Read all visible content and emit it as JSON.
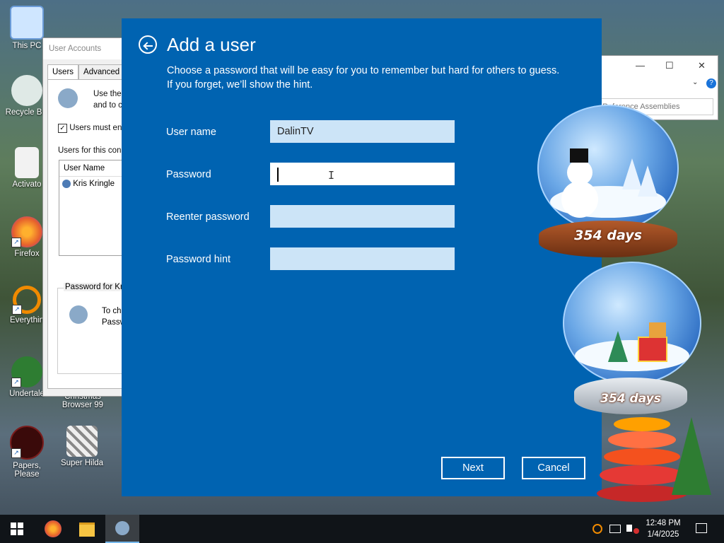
{
  "desktop": {
    "icons": [
      {
        "label": "This PC"
      },
      {
        "label": "Recycle Bin"
      },
      {
        "label": "Activato"
      },
      {
        "label": "Firefox"
      },
      {
        "label": "Everythin"
      },
      {
        "label": "Undertale"
      },
      {
        "label": "Papers, Please"
      },
      {
        "label": "Super Hilda"
      },
      {
        "label": "Christmas Browser 99"
      }
    ]
  },
  "user_accounts_window": {
    "title": "User Accounts",
    "tabs": [
      "Users",
      "Advanced"
    ],
    "intro_line1": "Use the",
    "intro_line2": "and to c",
    "checkbox_label": "Users must en",
    "users_for_label": "Users for this con",
    "list_header": "User Name",
    "list_user": "Kris Kringle",
    "password_group_label": "Password for Kr",
    "password_text1": "To ch",
    "password_text2": "Passw"
  },
  "explorer_window": {
    "search_placeholder": "Reference Assemblies"
  },
  "dialog": {
    "title": "Add a user",
    "description": "Choose a password that will be easy for you to remember but hard for others to guess. If you forget, we’ll show the hint.",
    "fields": {
      "username": {
        "label": "User name",
        "value": "DalinTV"
      },
      "password": {
        "label": "Password",
        "value": ""
      },
      "reenter": {
        "label": "Reenter password",
        "value": ""
      },
      "hint": {
        "label": "Password hint",
        "value": ""
      }
    },
    "buttons": {
      "next": "Next",
      "cancel": "Cancel"
    }
  },
  "countdown": {
    "label1": "354 days",
    "label2": "354 days"
  },
  "taskbar": {
    "time": "12:48 PM",
    "date": "1/4/2025",
    "items": [
      "start-icon",
      "firefox-icon",
      "file-explorer-icon",
      "user-accounts-icon"
    ],
    "tray_icons": [
      "search-icon",
      "network-icon",
      "volume-muted-icon",
      "notification-icon"
    ]
  },
  "colors": {
    "dialog_bg": "#0063b1",
    "input_bg": "#cce4f7",
    "taskbar_bg": "#101418"
  }
}
